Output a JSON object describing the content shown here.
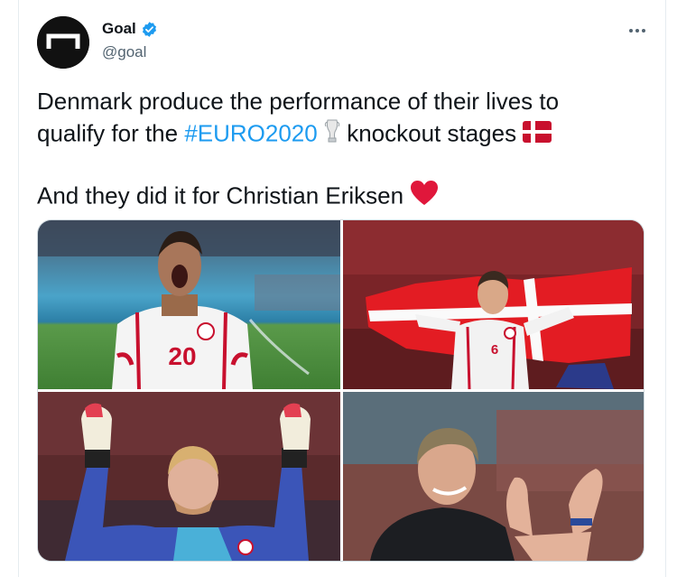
{
  "tweet": {
    "author": {
      "display_name": "Goal",
      "handle": "@goal",
      "verified": true,
      "avatar_icon": "goal-logo-icon"
    },
    "text": {
      "line1": "Denmark produce the performance of their lives to",
      "line2_prefix": "qualify for the ",
      "hashtag": "#EURO2020",
      "line2_suffix": " knockout stages",
      "line3": "And they did it for Christian Eriksen"
    },
    "emojis": [
      "euro-trophy-icon",
      "denmark-flag-icon",
      "red-heart-icon"
    ],
    "media": [
      {
        "name": "photo-player-20-celebrating",
        "jersey_number": "20"
      },
      {
        "name": "photo-player-6-with-flag",
        "jersey_number": "6"
      },
      {
        "name": "photo-goalkeeper-celebrating"
      },
      {
        "name": "photo-coach-applauding"
      }
    ]
  },
  "colors": {
    "hashtag": "#1d9bf0",
    "text": "#0f1419",
    "secondary": "#536471",
    "verified": "#1d9bf0",
    "denmark_red": "#c8102e"
  }
}
